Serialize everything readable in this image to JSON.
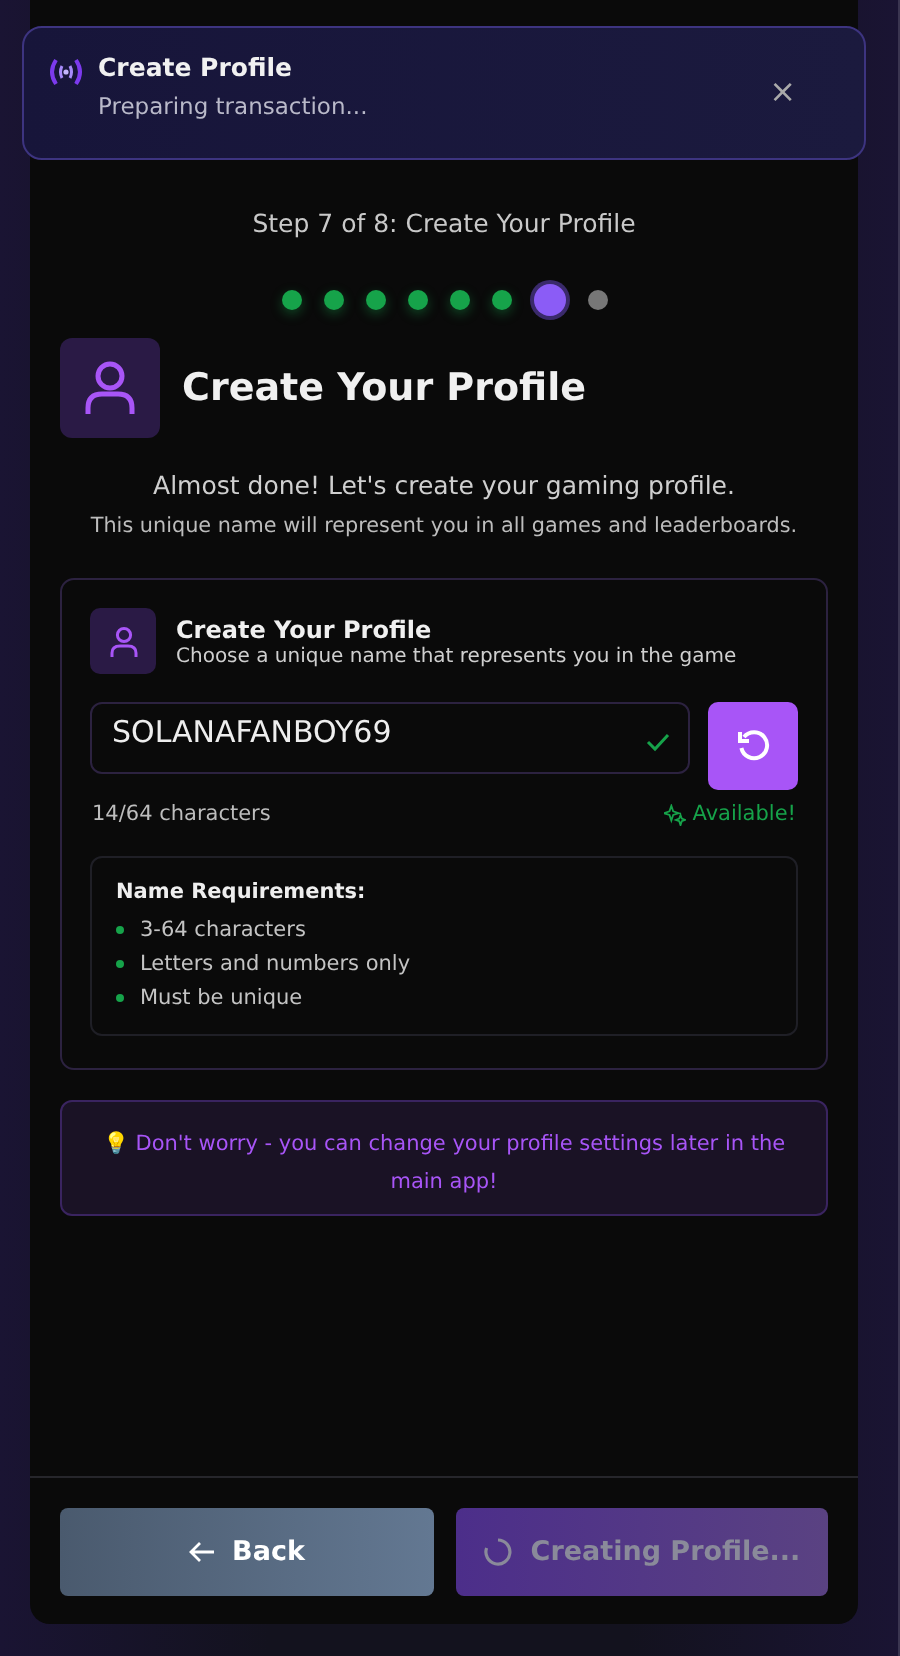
{
  "toast": {
    "title": "Create Profile",
    "message": "Preparing transaction...",
    "close": "×"
  },
  "header": {
    "step": "Step 7 of 8: Create Your Profile"
  },
  "steps": [
    {
      "completed": true,
      "selected": false
    },
    {
      "completed": true,
      "selected": false
    },
    {
      "completed": true,
      "selected": false
    },
    {
      "completed": true,
      "selected": false
    },
    {
      "completed": true,
      "selected": false
    },
    {
      "completed": true,
      "selected": false
    },
    {
      "completed": false,
      "selected": true
    },
    {
      "completed": false,
      "selected": false
    }
  ],
  "section": {
    "title": "Create Your Profile",
    "intro": "Almost done! Let's create your gaming profile.",
    "note": "This unique name will represent you in all games and leaderboards."
  },
  "card": {
    "title": "Create Your Profile",
    "subtitle": "Choose a unique name that represents you in the game",
    "value": "SOLANAFANBOY69",
    "valid": true,
    "counter": "14/64 characters",
    "availability": "Available!"
  },
  "requirements": {
    "title": "Name Requirements:",
    "items": [
      {
        "text": "3-64 characters",
        "met": true
      },
      {
        "text": "Letters and numbers only",
        "met": true
      },
      {
        "text": "Must be unique",
        "met": true
      }
    ]
  },
  "tip": "💡 Don't worry - you can change your profile settings later in the main app!",
  "footer": {
    "back": "Back",
    "next": "Creating Profile...",
    "loading": true
  }
}
